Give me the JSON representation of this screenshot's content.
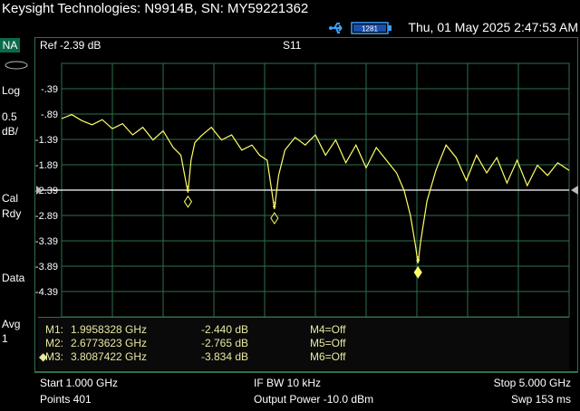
{
  "window": {
    "title": "Keysight Technologies: N9914B, SN: MY59221362"
  },
  "status": {
    "datetime": "Thu, 01 May 2025 2:47:53 AM",
    "battery_label": "1281"
  },
  "left_panel": {
    "mode": "NA",
    "format": "Log",
    "scale_value": "0.5",
    "scale_unit": "dB/",
    "cal_1": "Cal",
    "cal_2": "Rdy",
    "data": "Data",
    "avg_1": "Avg",
    "avg_2": "1"
  },
  "trace_header": {
    "ref": "Ref -2.39 dB",
    "measurement": "S11"
  },
  "colors": {
    "trace": "#ffff66",
    "grid": "#2e6f4c",
    "ref_line": "#ffffff",
    "marker_text": "#e8e8a0",
    "mode_bg": "#0b6a4a"
  },
  "y_ticks": [
    "-.39",
    "-.89",
    "-1.39",
    "-1.89",
    "-2.39",
    "-2.89",
    "-3.39",
    "-3.89",
    "-4.39"
  ],
  "markers": [
    {
      "name": "M1:",
      "freq": "1.9958328 GHz",
      "value": "-2.440 dB",
      "other": "M4=Off",
      "active": ""
    },
    {
      "name": "M2:",
      "freq": "2.6773623 GHz",
      "value": "-2.765 dB",
      "other": "M5=Off",
      "active": ""
    },
    {
      "name": "M3:",
      "freq": "3.8087422 GHz",
      "value": "-3.834 dB",
      "other": "M6=Off",
      "active": "◆"
    }
  ],
  "marker_labels": [
    "1",
    "2",
    "3"
  ],
  "footer": {
    "start": "Start 1.000 GHz",
    "ifbw": "IF BW 10 kHz",
    "stop": "Stop 5.000 GHz",
    "points": "Points 401",
    "power": "Output Power -10.0 dBm",
    "sweep": "Swp 153 ms"
  },
  "chart_data": {
    "type": "line",
    "title": "S11",
    "xlabel": "",
    "ylabel": "",
    "xlim": [
      1.0,
      5.0
    ],
    "ylim": [
      -4.89,
      0.11
    ],
    "reference_level": -2.39,
    "x": [
      1.0,
      1.08,
      1.16,
      1.24,
      1.32,
      1.4,
      1.48,
      1.56,
      1.64,
      1.72,
      1.8,
      1.88,
      1.94,
      1.97,
      1.9958,
      2.02,
      2.05,
      2.1,
      2.18,
      2.26,
      2.34,
      2.42,
      2.5,
      2.56,
      2.62,
      2.65,
      2.6774,
      2.71,
      2.76,
      2.84,
      2.92,
      3.0,
      3.08,
      3.16,
      3.24,
      3.32,
      3.4,
      3.48,
      3.56,
      3.64,
      3.7,
      3.75,
      3.79,
      3.8087,
      3.83,
      3.88,
      3.95,
      4.03,
      4.11,
      4.19,
      4.27,
      4.35,
      4.43,
      4.51,
      4.59,
      4.67,
      4.75,
      4.83,
      4.91,
      5.0
    ],
    "y": [
      -0.98,
      -0.9,
      -1.02,
      -1.1,
      -1.0,
      -1.18,
      -1.08,
      -1.3,
      -1.15,
      -1.4,
      -1.22,
      -1.55,
      -1.7,
      -2.1,
      -2.44,
      -1.8,
      -1.45,
      -1.32,
      -1.15,
      -1.4,
      -1.3,
      -1.6,
      -1.5,
      -1.7,
      -1.8,
      -2.3,
      -2.765,
      -2.1,
      -1.6,
      -1.35,
      -1.5,
      -1.3,
      -1.7,
      -1.4,
      -1.85,
      -1.5,
      -1.95,
      -1.55,
      -1.8,
      -2.05,
      -2.4,
      -2.9,
      -3.5,
      -3.834,
      -3.4,
      -2.6,
      -2.0,
      -1.5,
      -1.75,
      -2.2,
      -1.7,
      -2.05,
      -1.75,
      -2.25,
      -1.8,
      -2.3,
      -1.9,
      -2.1,
      -1.85,
      -2.0
    ],
    "markers": [
      {
        "label": "1",
        "x": 1.9958328,
        "y": -2.44
      },
      {
        "label": "2",
        "x": 2.6773623,
        "y": -2.765
      },
      {
        "label": "3",
        "x": 3.8087422,
        "y": -3.834
      }
    ]
  }
}
